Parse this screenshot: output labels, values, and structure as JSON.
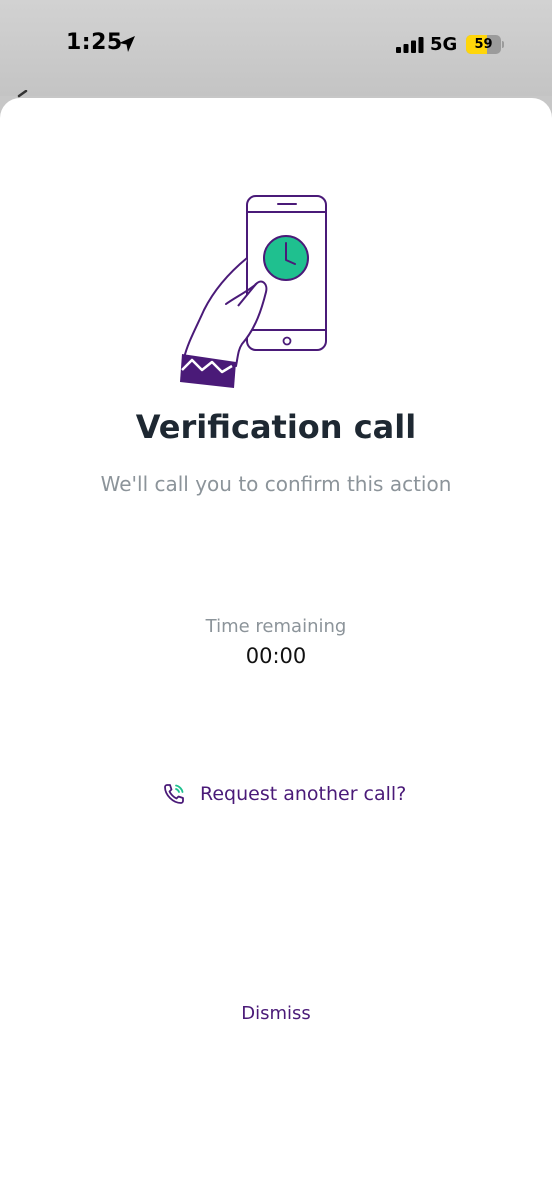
{
  "status_bar": {
    "time": "1:25",
    "network": "5G",
    "battery_level": "59",
    "battery_fraction": 0.59
  },
  "icons": {
    "location": "location-arrow-icon",
    "signal": "cellular-signal-icon",
    "illustration": "hand-holding-phone-clock-illustration",
    "phone": "phone-call-icon"
  },
  "colors": {
    "accent_purple": "#4a1a78",
    "clock_green": "#1fc08f",
    "title_text": "#1e2832",
    "muted_text": "#8c949a"
  },
  "dialog": {
    "title": "Verification call",
    "subtitle": "We'll call you to confirm this action",
    "timer_label": "Time remaining",
    "timer_value": "00:00",
    "request_label": "Request another call?",
    "dismiss_label": "Dismiss"
  }
}
